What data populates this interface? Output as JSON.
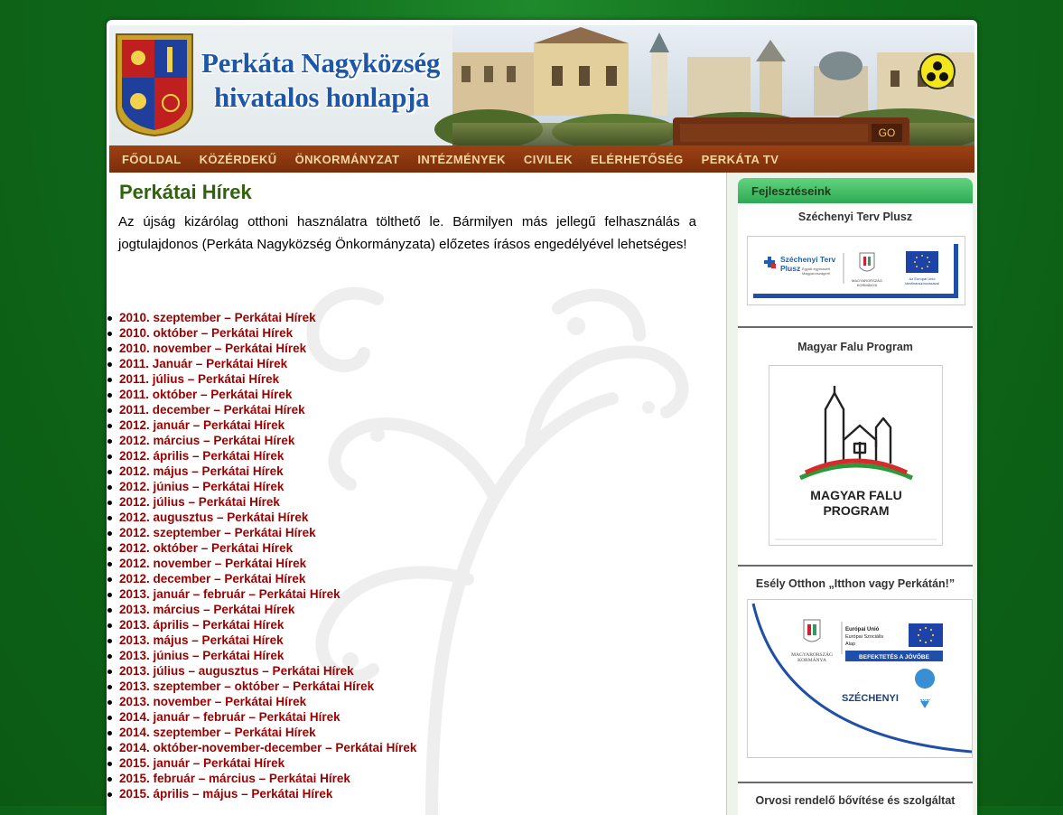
{
  "header": {
    "title_line1": "Perkáta Nagyközség",
    "title_line2": "hivatalos honlapja",
    "search_value": "",
    "search_button": "GO"
  },
  "nav": [
    "FŐOLDAL",
    "KÖZÉRDEKŰ",
    "ÖNKORMÁNYZAT",
    "INTÉZMÉNYEK",
    "CIVILEK",
    "ELÉRHETŐSÉG",
    "PERKÁTA TV"
  ],
  "main": {
    "heading": "Perkátai Hírek",
    "intro": "Az újság kizárólag otthoni használatra tölthető le. Bármilyen más jellegű felhasználás a jogtulajdonos (Perkáta Nagyközség Önkormányzata) előzetes írásos engedélyével lehetséges!",
    "news": [
      "2010. szeptember – Perkátai Hírek",
      "2010. október – Perkátai Hírek",
      "2010. november – Perkátai Hírek",
      "2011. Január – Perkátai Hírek",
      "2011. július – Perkátai Hírek",
      "2011. október – Perkátai Hírek",
      "2011. december – Perkátai Hírek",
      "2012. január – Perkátai Hírek",
      "2012. március – Perkátai Hírek",
      "2012. április – Perkátai Hírek",
      "2012. május – Perkátai Hírek",
      "2012. június – Perkátai Hírek",
      "2012. július – Perkátai Hírek",
      "2012. augusztus – Perkátai Hírek",
      "2012. szeptember – Perkátai Hírek",
      "2012. október – Perkátai Hírek",
      "2012. november – Perkátai Hírek",
      "2012. december – Perkátai Hírek",
      "2013. január – február – Perkátai Hírek",
      "2013. március – Perkátai Hírek",
      "2013. április – Perkátai Hírek",
      "2013. május – Perkátai Hírek",
      "2013. június – Perkátai Hírek",
      "2013. július – augusztus – Perkátai Hírek",
      "2013. szeptember – október – Perkátai Hírek",
      "2013. november – Perkátai Hírek",
      "2014. január – február – Perkátai Hírek",
      "2014. szeptember – Perkátai Hírek",
      "2014. október-november-december – Perkátai Hírek",
      "2015. január – Perkátai Hírek",
      "2015. február – március – Perkátai Hírek",
      "2015. április – május – Perkátai Hírek"
    ]
  },
  "sidebar": {
    "header": "Fejlesztéseink",
    "widgets": [
      {
        "title": "Széchenyi Terv Plusz",
        "logo_text": [
          "Széchenyi Terv",
          "Plusz",
          "Együtt egymásért",
          "Magyarországért!",
          "MAGYARORSZÁG",
          "KORMÁNYA",
          "Az Európai Unió",
          "társfinanszírozásával"
        ]
      },
      {
        "title": "Magyar Falu Program",
        "logo_text": [
          "MAGYAR FALU",
          "PROGRAM"
        ]
      },
      {
        "title": "Esély Otthon „Itthon vagy Perkátán!”",
        "logo_text": [
          "MAGYARORSZÁG",
          "KORMÁNYA",
          "Európai Unió",
          "Európai Szociális",
          "Alap",
          "BEFEKTETÉS A JÖVŐBE",
          "SZÉCHENYI",
          "2020"
        ]
      },
      {
        "title": "Orvosi rendelő bővítése és szolgáltat"
      }
    ]
  },
  "colors": {
    "background_green": "#0f6a1a",
    "nav_brown": "#8a370f",
    "nav_text": "#f7d5a0",
    "heading_green": "#31630e",
    "link_red": "#9b0000",
    "sidebar_header_green": "#2faa55"
  },
  "icons": {
    "coat_of_arms": "coat-of-arms-icon",
    "accessibility": "low-vision-accessibility-icon",
    "bullet": "bullet-icon"
  }
}
